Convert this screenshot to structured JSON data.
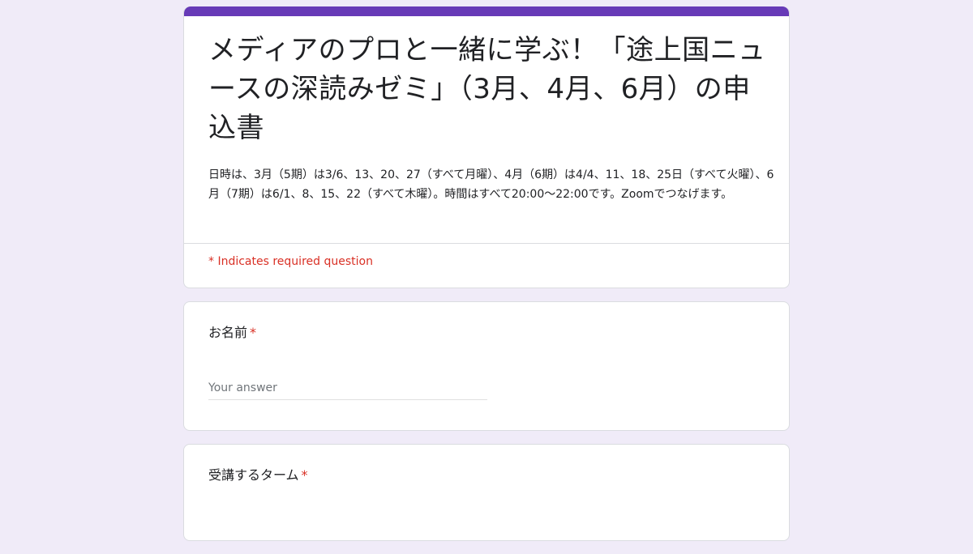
{
  "header": {
    "accent_color": "#673ab7",
    "title": "メディアのプロと一緒に学ぶ！「途上国ニュースの深読みゼミ」（3月、4月、6月）の申込書",
    "description": "日時は、3月（5期）は3/6、13、20、27（すべて月曜）、4月（6期）は4/4、11、18、25日（すべて火曜）、6月（7期）は6/1、8、15、22（すべて木曜）。時間はすべて20:00〜22:00です。Zoomでつなげます。",
    "required_note": "* Indicates required question"
  },
  "questions": [
    {
      "label": "お名前",
      "required_mark": "*",
      "placeholder": "Your answer"
    },
    {
      "label": "受講するターム",
      "required_mark": "*"
    }
  ],
  "colors": {
    "background": "#f0ebf8",
    "required": "#d93025"
  }
}
